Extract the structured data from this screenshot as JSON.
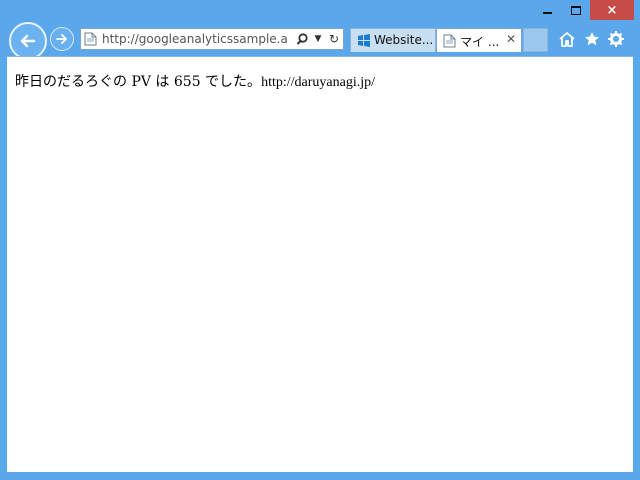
{
  "window": {
    "minimize_label": "",
    "maximize_label": "",
    "close_label": "×"
  },
  "toolbar": {
    "address": "http://googleanalyticssample.a",
    "search_icon": "search-icon",
    "dropdown_icon": "dropdown-icon",
    "refresh_icon": "refresh-icon"
  },
  "tabs": [
    {
      "label": "Website..."
    },
    {
      "label": "マイ ..."
    }
  ],
  "page": {
    "text": "昨日のだるろぐの PV は 655 でした。",
    "url": "http://daruyanagi.jp/"
  },
  "colors": {
    "frame": "#5aa7ec",
    "close_button": "#c74b46",
    "active_tab": "#ffffff",
    "inactive_tab": "#c8def1"
  }
}
